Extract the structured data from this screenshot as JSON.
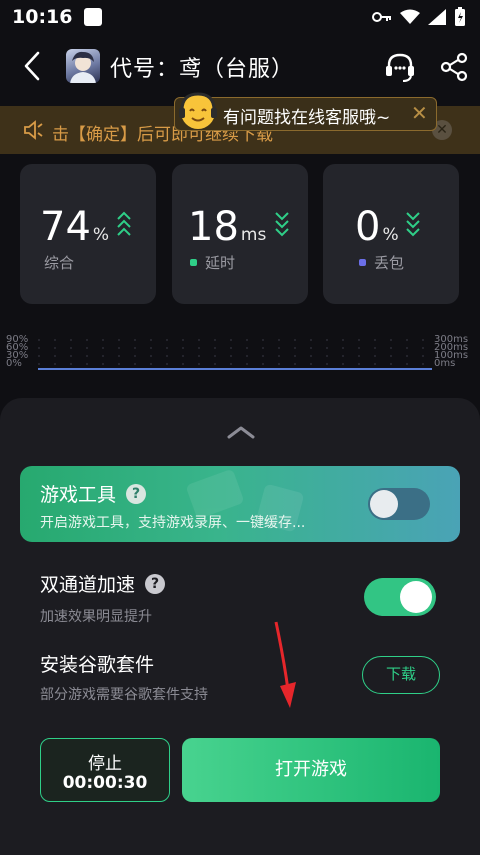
{
  "status_bar": {
    "time": "10:16"
  },
  "header": {
    "title": "代号：鸢（台服）"
  },
  "notice": {
    "text": "击【确定】后可即可继续下载"
  },
  "tooltip": {
    "text": "有问题找在线客服哦~",
    "close": "✕"
  },
  "stats": [
    {
      "value": "74",
      "unit": "%",
      "label": "综合",
      "trend": "up",
      "dot_color": ""
    },
    {
      "value": "18",
      "unit": "ms",
      "label": "延时",
      "trend": "down",
      "dot_color": "#2fcf88"
    },
    {
      "value": "0",
      "unit": "%",
      "label": "丢包",
      "trend": "down",
      "dot_color": "#6b6fe8"
    }
  ],
  "graph": {
    "left_axis": [
      "90%",
      "60%",
      "30%",
      "0%"
    ],
    "right_axis": [
      "300ms",
      "200ms",
      "100ms",
      "0ms"
    ]
  },
  "sheet": {
    "game_tool": {
      "title": "游戏工具",
      "subtitle": "开启游戏工具，支持游戏录屏、一键缓存...",
      "enabled": false
    },
    "dual_channel": {
      "title": "双通道加速",
      "subtitle": "加速效果明显提升",
      "enabled": true
    },
    "google_suite": {
      "title": "安装谷歌套件",
      "subtitle": "部分游戏需要谷歌套件支持",
      "button": "下载"
    },
    "stop": {
      "label": "停止",
      "time": "00:00:30"
    },
    "open_game": {
      "label": "打开游戏"
    }
  },
  "colors": {
    "accent": "#2fcf88",
    "notice_text": "#d89b47",
    "sheet_bg": "#1c1c21"
  }
}
